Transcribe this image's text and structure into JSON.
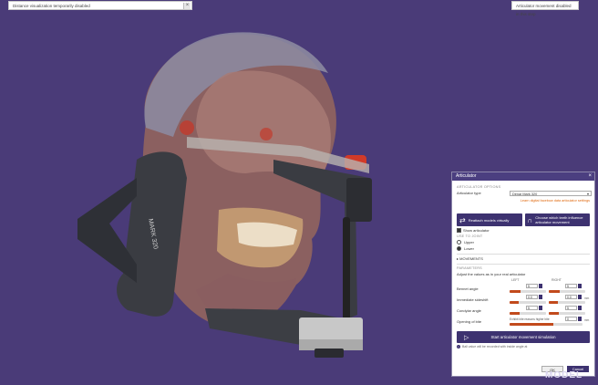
{
  "top_banner_left": {
    "text": "Distance visualization temporarily disabled",
    "close_label": "×"
  },
  "top_banner_right": {
    "text": "Articulator movement disabled in this step"
  },
  "articulator_label": "MARK 320",
  "panel": {
    "title": "Articulator",
    "close_label": "×",
    "articulator_options_header": "ARTICULATOR OPTIONS",
    "articulator_type_label": "Articulator type",
    "articulator_type_value": "Denar Mark 320",
    "learn_link": "Learn digital facebow data articulator settings",
    "reattach_button": "Reattach models virtually",
    "choose_teeth_button": "Choose which teeth influence articulator movement",
    "show_articulator_label": "Show articulator",
    "lead_joint_header": "USE TO JOINT",
    "radio_upper": "Upper",
    "radio_lower": "Lower",
    "movements_label": "MOVEMENTS",
    "parameters_header": "PARAMETERS",
    "adjust_text": "Adjust the values as in your real articulator",
    "col_left": "LEFT",
    "col_right": "RIGHT",
    "params": [
      {
        "label": "Bennet angle",
        "left_value": "5",
        "right_value": "5",
        "left_fill": 0.3,
        "right_fill": 0.3
      },
      {
        "label": "Immediate sideshift",
        "left_value": "0.0",
        "right_value": "0.0",
        "unit": "mm",
        "left_fill": 0.25,
        "right_fill": 0.25
      },
      {
        "label": "Condylar angle",
        "left_value": "5",
        "right_value": "5",
        "left_fill": 0.28,
        "right_fill": 0.28
      },
      {
        "label": "Opening of bite",
        "left_value": "0",
        "unit": "mm",
        "left_fill": 0.6,
        "slider_label": "Exhibit bite reasons higher bite"
      }
    ],
    "start_button": "Start articulator movement simulation",
    "note": "Ball value will be recorded with inside angle at",
    "ok_label": "OK",
    "cancel_label": "Cancel"
  },
  "watermark": "MODEL"
}
